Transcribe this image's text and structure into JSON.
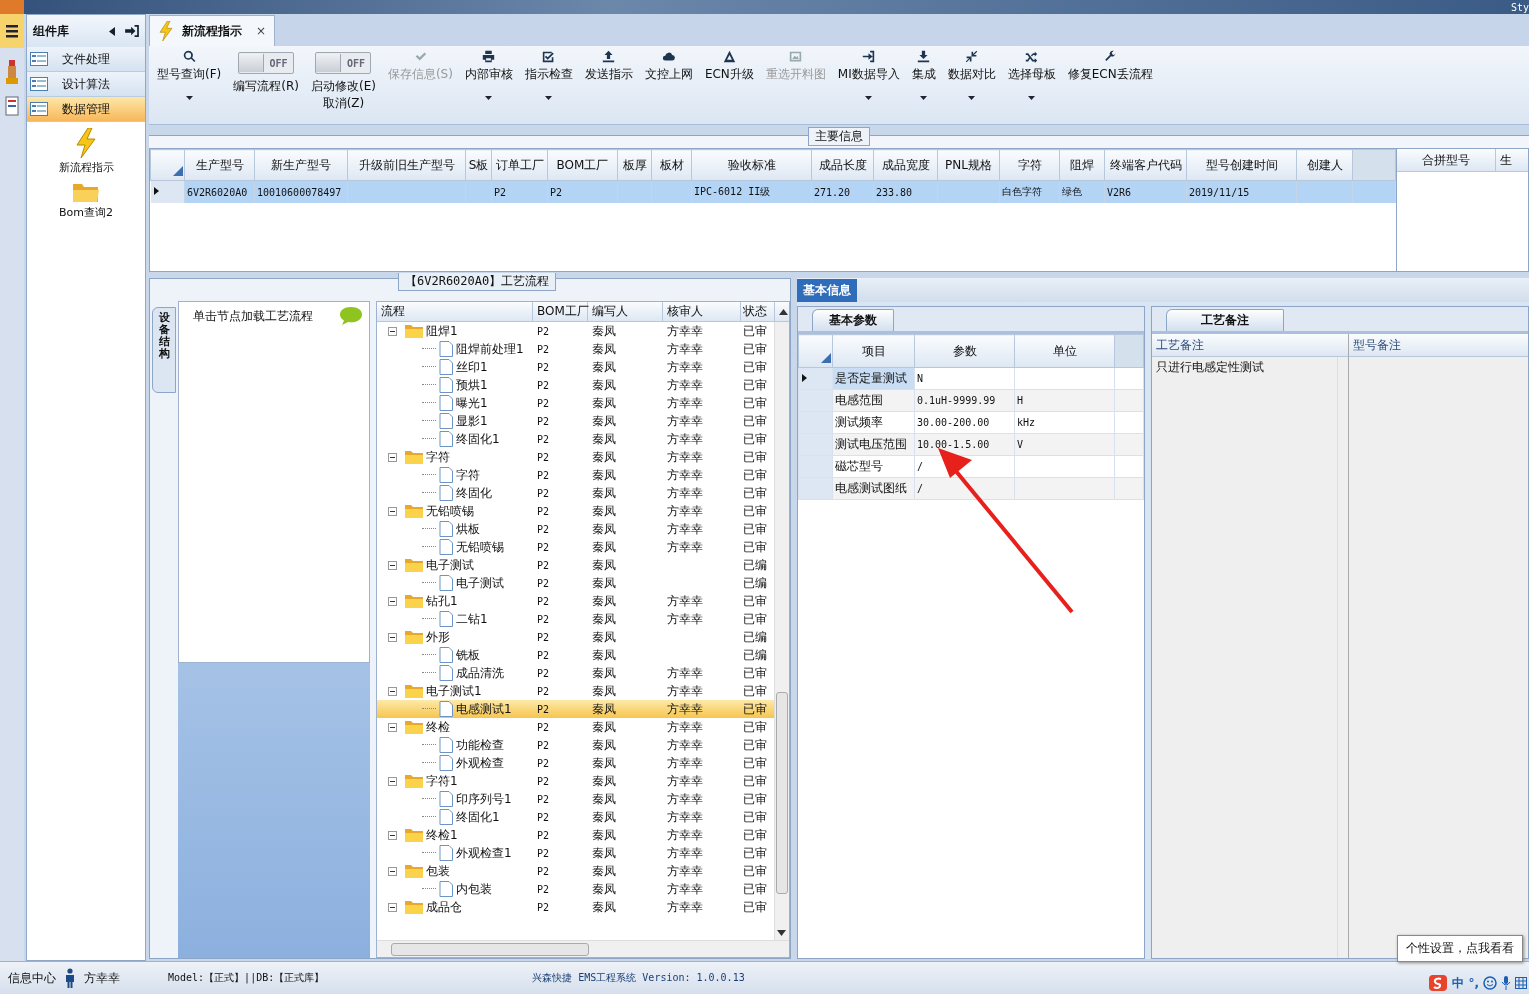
{
  "title_bar": {
    "text": "Sty"
  },
  "sidebar": {
    "title": "组件库",
    "items": [
      {
        "label": "文件处理",
        "selected": false
      },
      {
        "label": "设计算法",
        "selected": false
      },
      {
        "label": "数据管理",
        "selected": true
      }
    ],
    "tools": [
      {
        "label": "新流程指示"
      },
      {
        "label": "Bom查询2"
      }
    ]
  },
  "tabs": [
    {
      "label": "新流程指示",
      "selected": true,
      "close": "×"
    }
  ],
  "toolbar": {
    "items": [
      {
        "kind": "button",
        "label": "型号查询(F)",
        "dropdown": true,
        "disabled": false
      },
      {
        "kind": "toggle",
        "label": "编写流程(R)",
        "state": "OFF",
        "on": false
      },
      {
        "kind": "toggle",
        "label": "启动修改(E)\n取消(Z)",
        "state": "OFF",
        "on": false
      },
      {
        "kind": "button",
        "label": "保存信息(S)",
        "dropdown": false,
        "disabled": true
      },
      {
        "kind": "button",
        "label": "内部审核",
        "dropdown": true,
        "disabled": false
      },
      {
        "kind": "button",
        "label": "指示检查",
        "dropdown": true,
        "disabled": false
      },
      {
        "kind": "button",
        "label": "发送指示",
        "dropdown": false,
        "disabled": false
      },
      {
        "kind": "button",
        "label": "文控上网",
        "dropdown": false,
        "disabled": false
      },
      {
        "kind": "button",
        "label": "ECN升级",
        "dropdown": false,
        "disabled": false
      },
      {
        "kind": "button",
        "label": "重选开料图",
        "dropdown": false,
        "disabled": true
      },
      {
        "kind": "button",
        "label": "MI数据导入",
        "dropdown": true,
        "disabled": false
      },
      {
        "kind": "button",
        "label": "集成",
        "dropdown": true,
        "disabled": false
      },
      {
        "kind": "button",
        "label": "数据对比",
        "dropdown": true,
        "disabled": false
      },
      {
        "kind": "button",
        "label": "选择母板",
        "dropdown": true,
        "disabled": false
      },
      {
        "kind": "button",
        "label": "修复ECN丢流程",
        "dropdown": false,
        "disabled": false
      }
    ]
  },
  "main_info": {
    "title": "主要信息",
    "columns": [
      "生产型号",
      "新生产型号",
      "升级前旧生产型号",
      "S板",
      "订单工厂",
      "BOM工厂",
      "板厚",
      "板材",
      "验收标准",
      "成品长度",
      "成品宽度",
      "PNL规格",
      "字符",
      "阻焊",
      "终端客户代码",
      "型号创建时间",
      "创建人"
    ],
    "rows": [
      {
        "selected": true,
        "cells": [
          "6V2R6020A0",
          "10010600078497",
          null,
          null,
          "P2",
          "P2",
          null,
          null,
          "IPC-6012 II级",
          "271.20",
          "233.80",
          null,
          "白色字符",
          "绿色",
          "V2R6",
          "2019/11/15",
          null
        ]
      }
    ],
    "side_columns": [
      "合拼型号",
      "生"
    ]
  },
  "process": {
    "title": "【6V2R6020A0】工艺流程",
    "vertical_tab": "设备结构",
    "hint": "单击节点加载工艺流程",
    "columns": [
      "流程",
      "BOM工厂",
      "编写人",
      "核审人",
      "状态"
    ],
    "nodes": [
      {
        "kind": "folder",
        "name": "阻焊1",
        "bom": "P2",
        "writer": "秦凤",
        "checker": "方幸幸",
        "status": "已审",
        "expanded": true,
        "selected": false,
        "children": [
          {
            "kind": "file",
            "name": "阻焊前处理1",
            "bom": "P2",
            "writer": "秦凤",
            "checker": "方幸幸",
            "status": "已审",
            "selected": false
          },
          {
            "kind": "file",
            "name": "丝印1",
            "bom": "P2",
            "writer": "秦凤",
            "checker": "方幸幸",
            "status": "已审",
            "selected": false
          },
          {
            "kind": "file",
            "name": "预烘1",
            "bom": "P2",
            "writer": "秦凤",
            "checker": "方幸幸",
            "status": "已审",
            "selected": false
          },
          {
            "kind": "file",
            "name": "曝光1",
            "bom": "P2",
            "writer": "秦凤",
            "checker": "方幸幸",
            "status": "已审",
            "selected": false
          },
          {
            "kind": "file",
            "name": "显影1",
            "bom": "P2",
            "writer": "秦凤",
            "checker": "方幸幸",
            "status": "已审",
            "selected": false
          },
          {
            "kind": "file",
            "name": "终固化1",
            "bom": "P2",
            "writer": "秦凤",
            "checker": "方幸幸",
            "status": "已审",
            "selected": false
          }
        ]
      },
      {
        "kind": "folder",
        "name": "字符",
        "bom": "P2",
        "writer": "秦凤",
        "checker": "方幸幸",
        "status": "已审",
        "expanded": true,
        "selected": false,
        "children": [
          {
            "kind": "file",
            "name": "字符",
            "bom": "P2",
            "writer": "秦凤",
            "checker": "方幸幸",
            "status": "已审",
            "selected": false
          },
          {
            "kind": "file",
            "name": "终固化",
            "bom": "P2",
            "writer": "秦凤",
            "checker": "方幸幸",
            "status": "已审",
            "selected": false
          }
        ]
      },
      {
        "kind": "folder",
        "name": "无铅喷锡",
        "bom": "P2",
        "writer": "秦凤",
        "checker": "方幸幸",
        "status": "已审",
        "expanded": true,
        "selected": false,
        "children": [
          {
            "kind": "file",
            "name": "烘板",
            "bom": "P2",
            "writer": "秦凤",
            "checker": "方幸幸",
            "status": "已审",
            "selected": false
          },
          {
            "kind": "file",
            "name": "无铅喷锡",
            "bom": "P2",
            "writer": "秦凤",
            "checker": "方幸幸",
            "status": "已审",
            "selected": false
          }
        ]
      },
      {
        "kind": "folder",
        "name": "电子测试",
        "bom": "P2",
        "writer": "秦凤",
        "status": "已编",
        "expanded": true,
        "selected": false,
        "children": [
          {
            "kind": "file",
            "name": "电子测试",
            "bom": "P2",
            "writer": "秦凤",
            "status": "已编",
            "selected": false
          }
        ]
      },
      {
        "kind": "folder",
        "name": "钻孔1",
        "bom": "P2",
        "writer": "秦凤",
        "checker": "方幸幸",
        "status": "已审",
        "expanded": true,
        "selected": false,
        "children": [
          {
            "kind": "file",
            "name": "二钻1",
            "bom": "P2",
            "writer": "秦凤",
            "checker": "方幸幸",
            "status": "已审",
            "selected": false
          }
        ]
      },
      {
        "kind": "folder",
        "name": "外形",
        "bom": "P2",
        "writer": "秦凤",
        "status": "已编",
        "expanded": true,
        "selected": false,
        "children": [
          {
            "kind": "file",
            "name": "铣板",
            "bom": "P2",
            "writer": "秦凤",
            "status": "已编",
            "selected": false
          },
          {
            "kind": "file",
            "name": "成品清洗",
            "bom": "P2",
            "writer": "秦凤",
            "checker": "方幸幸",
            "status": "已审",
            "selected": false
          }
        ]
      },
      {
        "kind": "folder",
        "name": "电子测试1",
        "bom": "P2",
        "writer": "秦凤",
        "checker": "方幸幸",
        "status": "已审",
        "expanded": true,
        "selected": false,
        "children": [
          {
            "kind": "file",
            "name": "电感测试1",
            "bom": "P2",
            "writer": "秦凤",
            "checker": "方幸幸",
            "status": "已审",
            "selected": true
          }
        ]
      },
      {
        "kind": "folder",
        "name": "终检",
        "bom": "P2",
        "writer": "秦凤",
        "checker": "方幸幸",
        "status": "已审",
        "expanded": true,
        "selected": false,
        "children": [
          {
            "kind": "file",
            "name": "功能检查",
            "bom": "P2",
            "writer": "秦凤",
            "checker": "方幸幸",
            "status": "已审",
            "selected": false
          },
          {
            "kind": "file",
            "name": "外观检查",
            "bom": "P2",
            "writer": "秦凤",
            "checker": "方幸幸",
            "status": "已审",
            "selected": false
          }
        ]
      },
      {
        "kind": "folder",
        "name": "字符1",
        "bom": "P2",
        "writer": "秦凤",
        "checker": "方幸幸",
        "status": "已审",
        "expanded": true,
        "selected": false,
        "children": [
          {
            "kind": "file",
            "name": "印序列号1",
            "bom": "P2",
            "writer": "秦凤",
            "checker": "方幸幸",
            "status": "已审",
            "selected": false
          },
          {
            "kind": "file",
            "name": "终固化1",
            "bom": "P2",
            "writer": "秦凤",
            "checker": "方幸幸",
            "status": "已审",
            "selected": false
          }
        ]
      },
      {
        "kind": "folder",
        "name": "终检1",
        "bom": "P2",
        "writer": "秦凤",
        "checker": "方幸幸",
        "status": "已审",
        "expanded": true,
        "selected": false,
        "children": [
          {
            "kind": "file",
            "name": "外观检查1",
            "bom": "P2",
            "writer": "秦凤",
            "checker": "方幸幸",
            "status": "已审",
            "selected": false
          }
        ]
      },
      {
        "kind": "folder",
        "name": "包装",
        "bom": "P2",
        "writer": "秦凤",
        "checker": "方幸幸",
        "status": "已审",
        "expanded": true,
        "selected": false,
        "children": [
          {
            "kind": "file",
            "name": "内包装",
            "bom": "P2",
            "writer": "秦凤",
            "checker": "方幸幸",
            "status": "已审",
            "selected": false
          }
        ]
      },
      {
        "kind": "folder",
        "name": "成品仓",
        "bom": "P2",
        "writer": "秦凤",
        "checker": "方幸幸",
        "status": "已审",
        "expanded": true,
        "selected": false
      }
    ]
  },
  "basic_info": {
    "tab": "基本信息",
    "params": {
      "tab": "基本参数",
      "columns": [
        "项目",
        "参数",
        "单位"
      ],
      "rows": [
        {
          "item": "是否定量测试",
          "value": "N",
          "selected": true
        },
        {
          "item": "电感范围",
          "value": "0.1uH-9999.99",
          "unit": "H",
          "selected": false
        },
        {
          "item": "测试频率",
          "value": "30.00-200.00",
          "unit": "kHz",
          "selected": false
        },
        {
          "item": "测试电压范围",
          "value": "10.00-1.5.00",
          "unit": "V",
          "selected": false
        },
        {
          "item": "磁芯型号",
          "value": "/",
          "selected": false
        },
        {
          "item": "电感测试图纸",
          "value": "/",
          "selected": false
        }
      ]
    },
    "remarks": {
      "tab": "工艺备注",
      "columns": [
        "工艺备注",
        "型号备注"
      ],
      "process_remark": "只进行电感定性测试"
    }
  },
  "status_bar": {
    "info_center": "信息中心",
    "user": "方幸幸",
    "db": "Model:【正式】||DB:【正式库】",
    "product": "兴森快捷  EMS工程系统  Version: 1.0.0.13",
    "tooltip": "个性设置，点我看看",
    "ime": "中",
    "punct": "°,"
  }
}
